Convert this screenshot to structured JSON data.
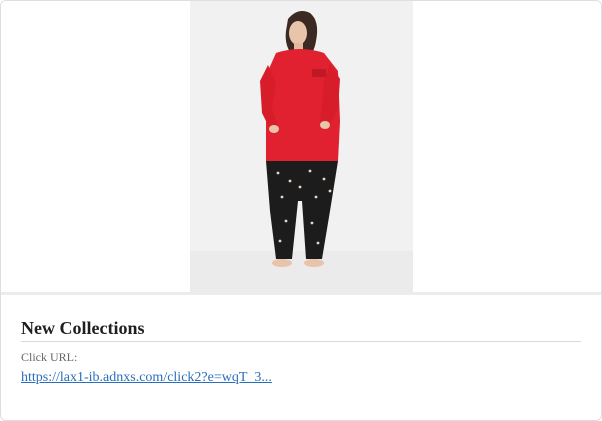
{
  "card": {
    "title": "New Collections",
    "click_url_label": "Click URL:",
    "click_url": "https://lax1-ib.adnxs.com/click2?e=wqT_3..."
  },
  "image": {
    "icon": "product-photo-woman-pajamas",
    "colors": {
      "top": "#e1212f",
      "pants": "#1c1c1c",
      "background": "#f1f1f1"
    }
  },
  "colors": {
    "link": "#2a6ebb",
    "title": "#1f1f1f"
  }
}
